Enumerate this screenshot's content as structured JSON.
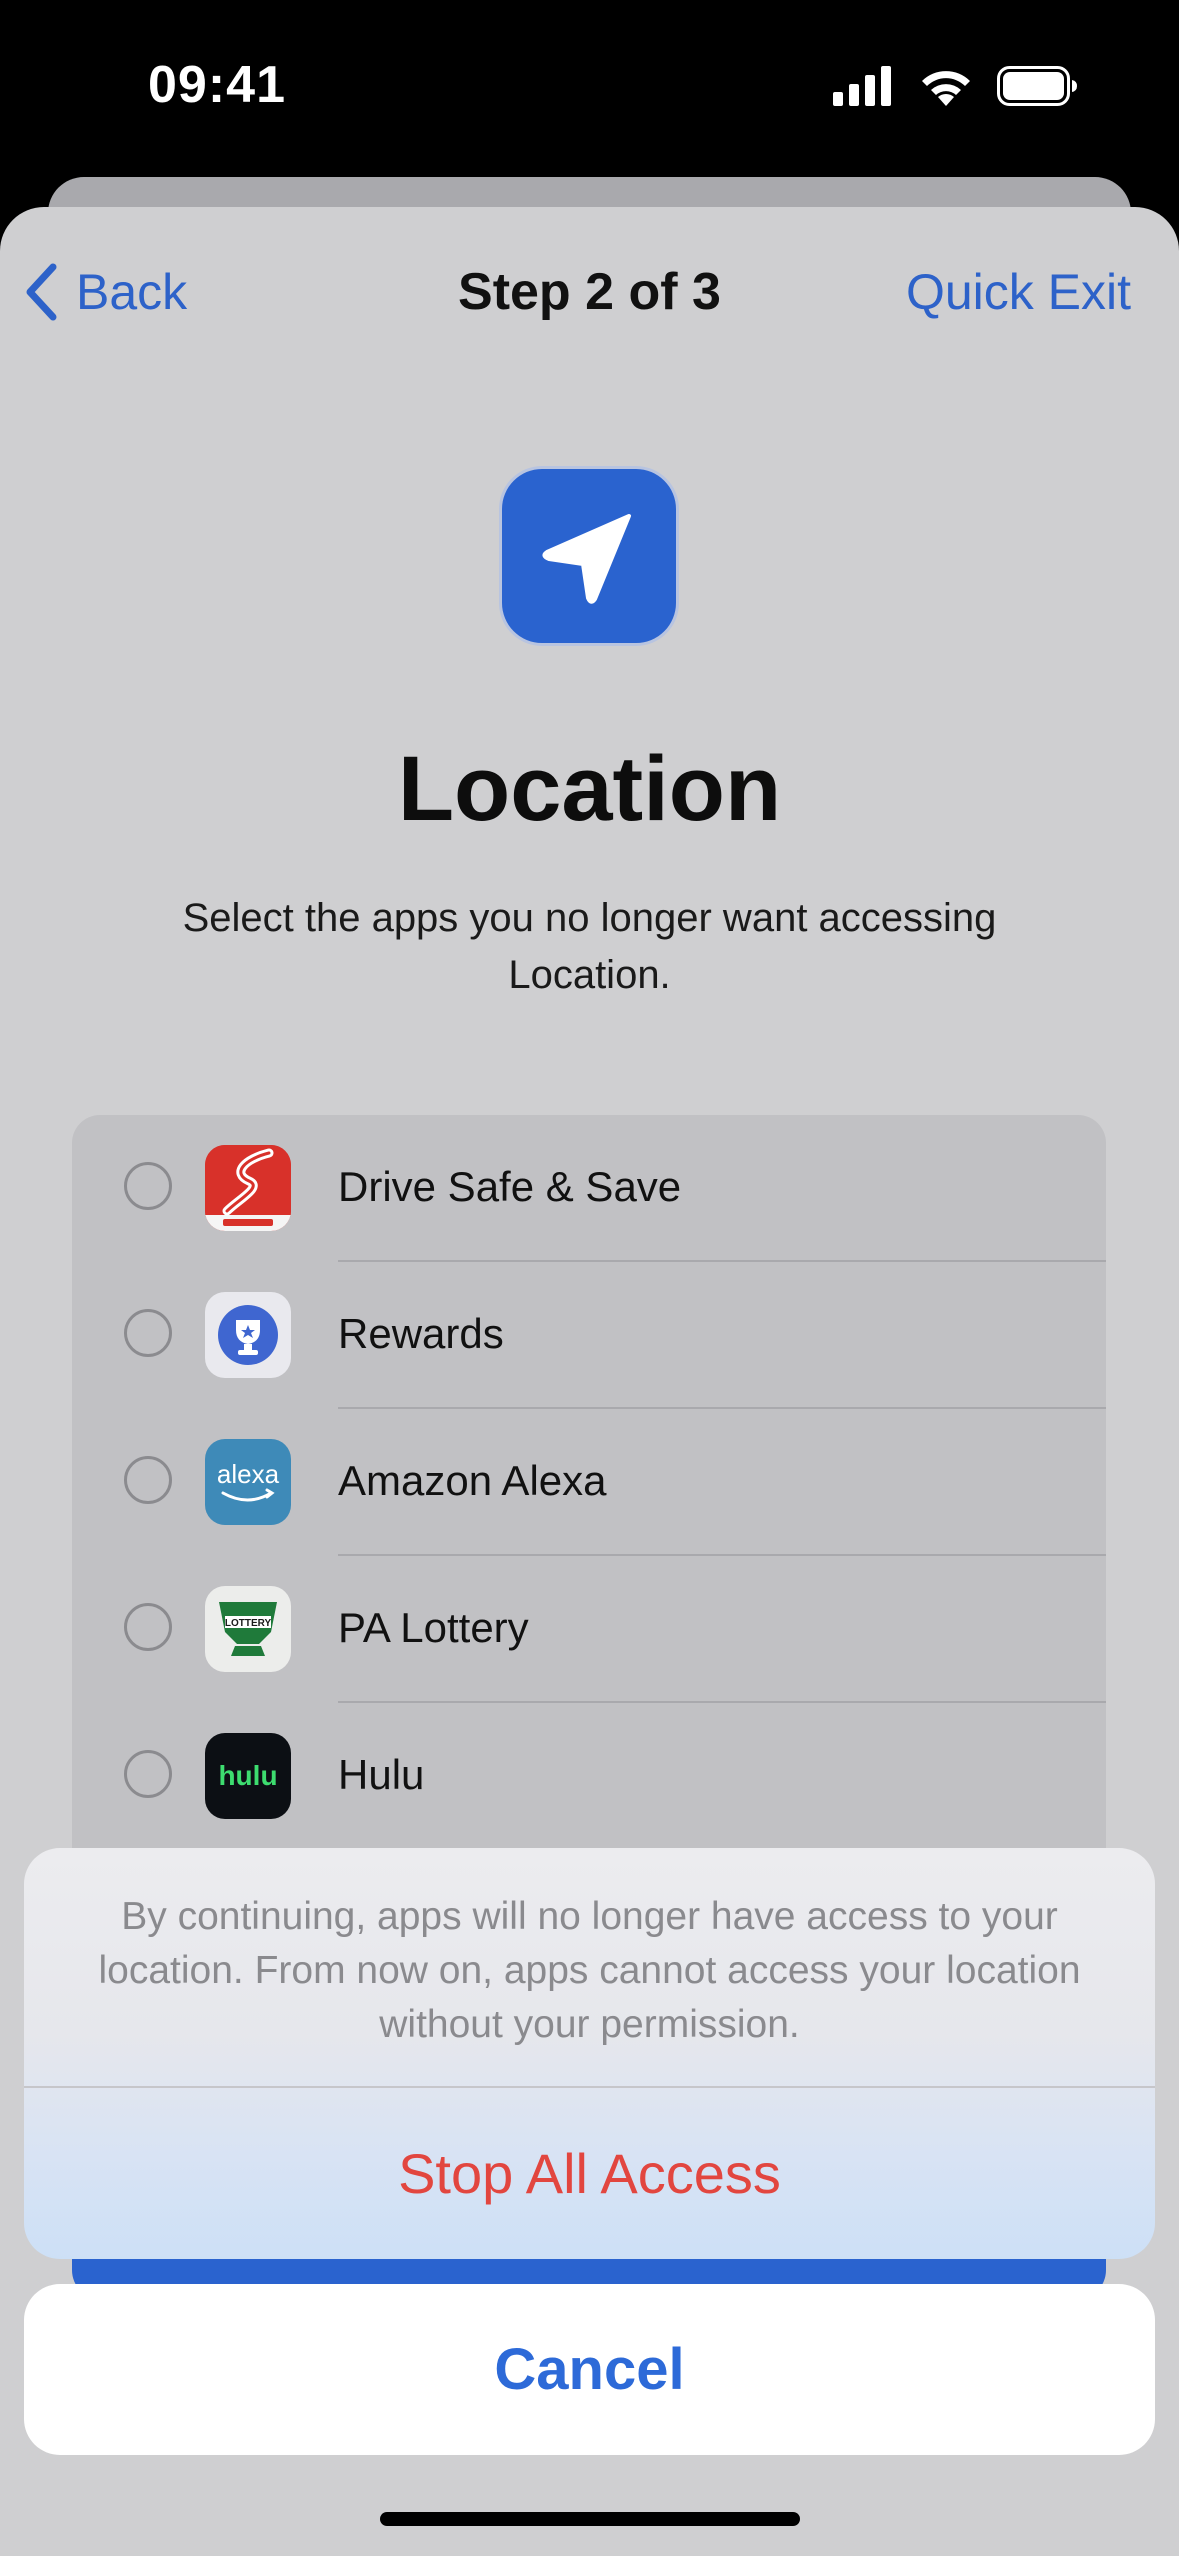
{
  "status_bar": {
    "time": "09:41"
  },
  "nav": {
    "back_label": "Back",
    "title": "Step 2 of 3",
    "quick_exit_label": "Quick Exit"
  },
  "page": {
    "title": "Location",
    "subtitle": "Select the apps you no longer want accessing Location."
  },
  "apps": [
    {
      "name": "Drive Safe & Save",
      "icon": "drive-safe-save-app-icon",
      "selected": false
    },
    {
      "name": "Rewards",
      "icon": "rewards-app-icon",
      "selected": false
    },
    {
      "name": "Amazon Alexa",
      "icon": "amazon-alexa-app-icon",
      "icon_text": "alexa",
      "selected": false
    },
    {
      "name": "PA Lottery",
      "icon": "pa-lottery-app-icon",
      "icon_text": "LOTTERY",
      "selected": false
    },
    {
      "name": "Hulu",
      "icon": "hulu-app-icon",
      "icon_text": "hulu",
      "selected": false
    }
  ],
  "action_sheet": {
    "message": "By continuing, apps will no longer have access to your location. From now on, apps cannot access your location without your permission.",
    "stop_label": "Stop All Access",
    "cancel_label": "Cancel"
  },
  "colors": {
    "accent": "#2d62c9",
    "destructive": "#e2463f",
    "location_icon_bg": "#2a63cf"
  }
}
